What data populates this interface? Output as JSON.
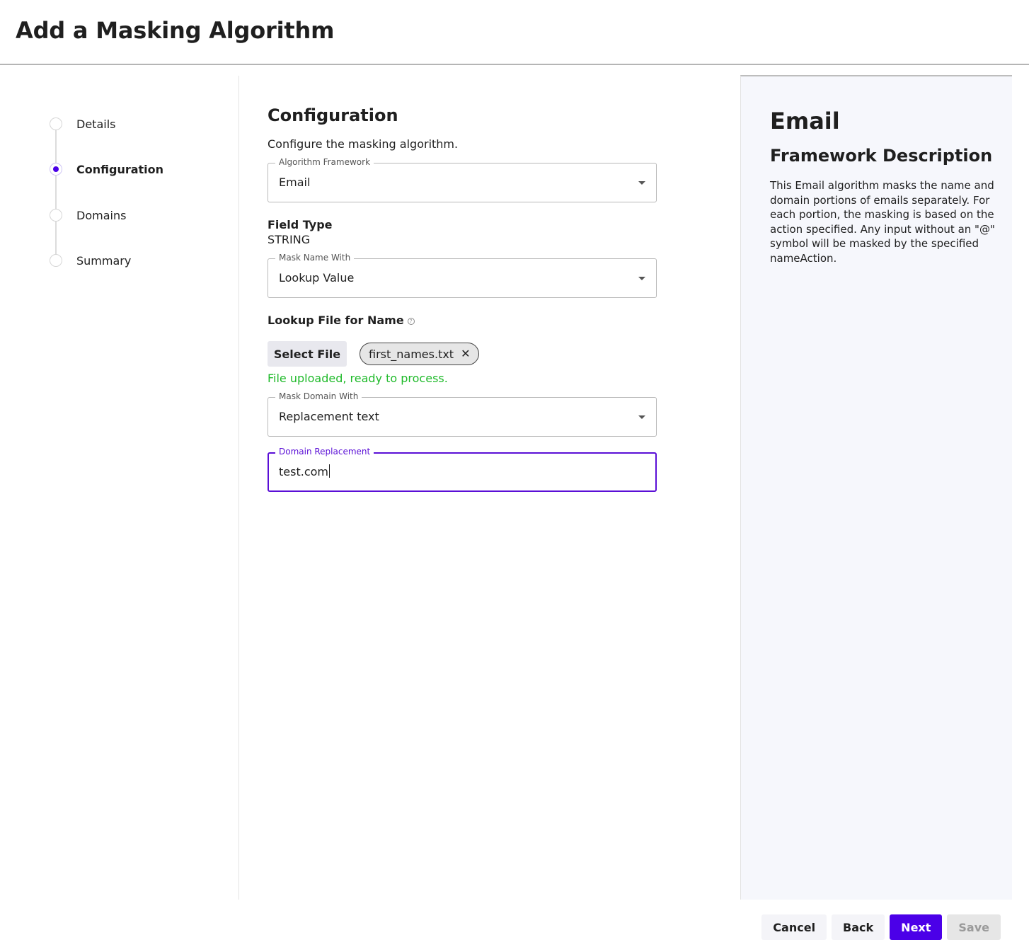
{
  "header": {
    "title": "Add a Masking Algorithm"
  },
  "stepper": {
    "steps": [
      {
        "label": "Details",
        "active": false
      },
      {
        "label": "Configuration",
        "active": true
      },
      {
        "label": "Domains",
        "active": false
      },
      {
        "label": "Summary",
        "active": false
      }
    ]
  },
  "config": {
    "title": "Configuration",
    "subtitle": "Configure the masking algorithm.",
    "algorithm_framework": {
      "label": "Algorithm Framework",
      "value": "Email"
    },
    "field_type": {
      "label": "Field Type",
      "value": "STRING"
    },
    "mask_name_with": {
      "label": "Mask Name With",
      "value": "Lookup Value"
    },
    "lookup_file": {
      "label": "Lookup File for Name",
      "help_icon_glyph": "?",
      "select_button": "Select File",
      "file_name": "first_names.txt",
      "remove_glyph": "✕",
      "status": "File uploaded, ready to process."
    },
    "mask_domain_with": {
      "label": "Mask Domain With",
      "value": "Replacement text"
    },
    "domain_replacement": {
      "label": "Domain Replacement",
      "value": "test.com"
    }
  },
  "panel": {
    "title": "Email",
    "subtitle": "Framework Description",
    "description": "This Email algorithm masks the name and domain portions of emails separately. For each portion, the masking is based on the action specified. Any input without an \"@\" symbol will be masked by the specified nameAction."
  },
  "footer": {
    "cancel": "Cancel",
    "back": "Back",
    "next": "Next",
    "save": "Save"
  },
  "colors": {
    "accent": "#4b00e8",
    "success": "#1fba2a",
    "focus": "#5a0fd6"
  }
}
